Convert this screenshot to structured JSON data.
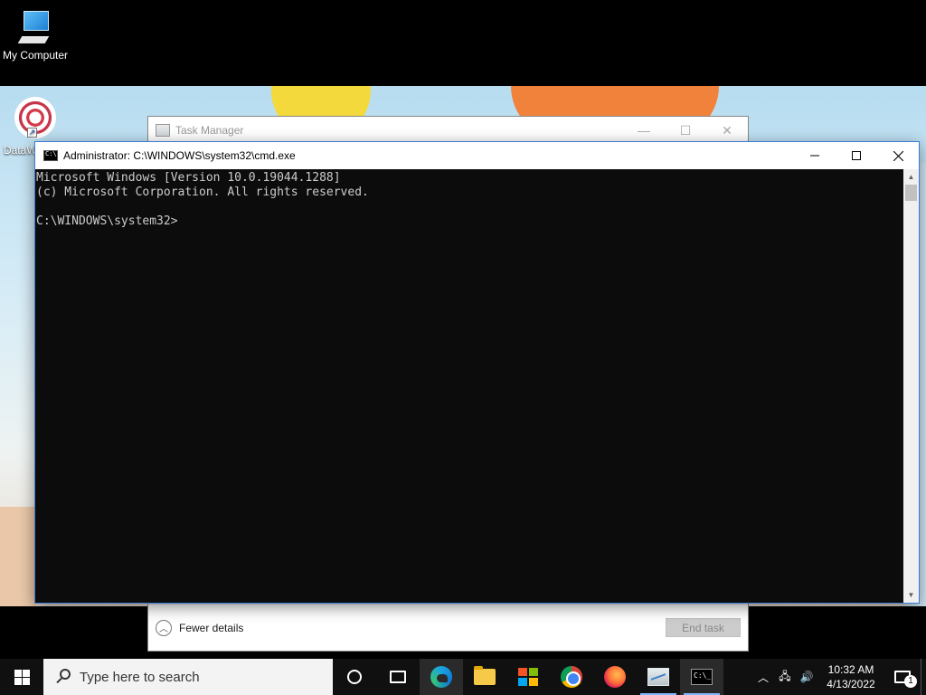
{
  "desktop": {
    "icons": [
      {
        "label": "My Computer",
        "icon": "computer-icon"
      },
      {
        "label": "DataW",
        "icon": "datawatch-icon"
      }
    ]
  },
  "task_manager": {
    "title": "Task Manager",
    "fewer_details": "Fewer details",
    "end_task": "End task"
  },
  "cmd": {
    "title": "Administrator: C:\\WINDOWS\\system32\\cmd.exe",
    "console_lines": [
      "Microsoft Windows [Version 10.0.19044.1288]",
      "(c) Microsoft Corporation. All rights reserved.",
      "",
      "C:\\WINDOWS\\system32>"
    ]
  },
  "taskbar": {
    "search_placeholder": "Type here to search",
    "pinned": [
      "cortana-icon",
      "task-view-icon",
      "edge-icon",
      "file-explorer-icon",
      "store-icon",
      "chrome-icon",
      "firefox-icon",
      "task-manager-icon",
      "cmd-icon"
    ],
    "clock_time": "10:32 AM",
    "clock_date": "4/13/2022",
    "notification_count": "1"
  },
  "colors": {
    "console_bg": "#0c0c0c",
    "console_fg": "#cccccc",
    "taskbar_bg": "#101010",
    "window_border": "#3b7bd5"
  }
}
